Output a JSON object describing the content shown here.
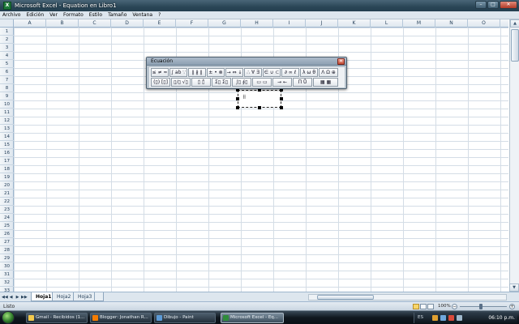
{
  "window": {
    "title": "Microsoft Excel - Equation en Libro1",
    "app_icon": "excel-icon",
    "controls": {
      "minimize": "–",
      "maximize": "□",
      "close": "✕"
    }
  },
  "menu": [
    "Archivo",
    "Edición",
    "Ver",
    "Formato",
    "Estilo",
    "Tamaño",
    "Ventana",
    "?"
  ],
  "sheet": {
    "columns": [
      "A",
      "B",
      "C",
      "D",
      "E",
      "F",
      "G",
      "H",
      "I",
      "J",
      "K",
      "L",
      "M",
      "N",
      "O"
    ],
    "rows": [
      "1",
      "2",
      "3",
      "4",
      "5",
      "6",
      "7",
      "8",
      "9",
      "10",
      "11",
      "12",
      "13",
      "14",
      "15",
      "16",
      "17",
      "18",
      "19",
      "20",
      "21",
      "22",
      "23",
      "24",
      "25",
      "26",
      "27",
      "28",
      "29",
      "30",
      "31",
      "32",
      "33"
    ]
  },
  "equation_toolbar": {
    "title": "Ecuación",
    "close": "✕",
    "row1": [
      "≤ ≠ ≈",
      "∫ ab ∵",
      "∥ ∦ ∥",
      "± • ⊗",
      "→ ⇔ ↓",
      "∴ ∀ ∃",
      "∈ ∪ ⊂",
      "∂ ∞ ℓ",
      "λ ω θ",
      "Λ Ω ⊕"
    ],
    "row2": [
      "(▯) [▯]",
      "▯/▯ √▯",
      "▯̇ ▯̂",
      "Σ▯ Σ▯",
      "∫▯ ∮▯",
      "▭ ▭",
      "→ ←",
      "Π̇ Ů",
      "▦ ▦"
    ]
  },
  "tabs": {
    "nav": [
      "◀◀",
      "◀",
      "▶",
      "▶▶"
    ],
    "sheets": [
      "Hoja1",
      "Hoja2",
      "Hoja3"
    ],
    "active": "Hoja1"
  },
  "status": {
    "text": "Listo",
    "zoom": "100%",
    "zoom_minus": "−",
    "zoom_plus": "+"
  },
  "taskbar": {
    "items": [
      {
        "label": "Gmail - Recibidos (1...",
        "icon": "gmail-icon",
        "color": "#f2c94c"
      },
      {
        "label": "Blogger: Jonathan R...",
        "icon": "blogger-icon",
        "color": "#f57c00"
      },
      {
        "label": "Dibujo - Paint",
        "icon": "paint-icon",
        "color": "#5c9ad6"
      },
      {
        "label": "Microsoft Excel - Eq...",
        "icon": "excel-icon",
        "color": "#2e8b3a"
      }
    ],
    "language": "ES",
    "clock": "06:10 p.m."
  }
}
